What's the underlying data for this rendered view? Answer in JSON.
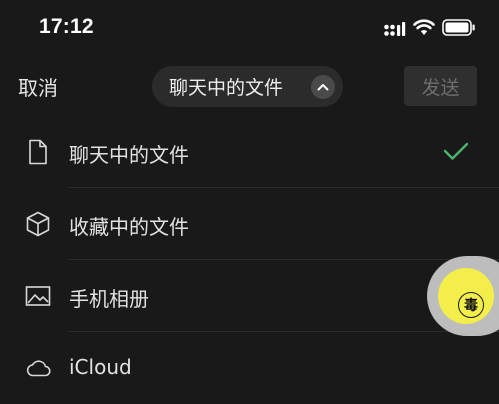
{
  "status_bar": {
    "time": "17:12",
    "icons": [
      "signal-icon",
      "wifi-icon",
      "battery-icon"
    ]
  },
  "nav": {
    "cancel_label": "取消",
    "title": "聊天中的文件",
    "title_chevron_icon": "chevron-up-icon",
    "send_label": "发送",
    "send_enabled": false
  },
  "list": {
    "items": [
      {
        "label": "聊天中的文件",
        "icon": "document-icon",
        "selected": true
      },
      {
        "label": "收藏中的文件",
        "icon": "cube-icon",
        "selected": false
      },
      {
        "label": "手机相册",
        "icon": "photo-icon",
        "selected": false
      },
      {
        "label": "iCloud",
        "icon": "cloud-icon",
        "selected": false
      }
    ],
    "selected_check_icon": "checkmark-icon"
  },
  "floating_button": {
    "badge_text": "毒",
    "icon": "assistive-touch-icon"
  },
  "colors": {
    "background": "#191919",
    "pill_background": "#2b2b2b",
    "check_green": "#4cb56b",
    "send_disabled_text": "#6d6d6d",
    "float_yellow": "#f3ee4a"
  }
}
